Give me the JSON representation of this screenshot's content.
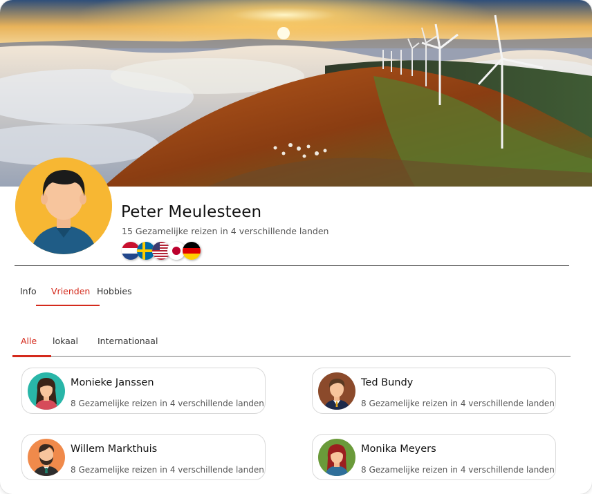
{
  "profile": {
    "name": "Peter Meulesteen",
    "subtitle": "15 Gezamelijke reizen in 4 verschillende landen",
    "flags": [
      "netherlands-flag-icon",
      "sweden-flag-icon",
      "usa-flag-icon",
      "japan-flag-icon",
      "germany-flag-icon"
    ]
  },
  "tabs": {
    "info": "Info",
    "vrienden": "Vrienden",
    "hobbies": "Hobbies",
    "active": "Vrienden"
  },
  "subtabs": {
    "alle": "Alle",
    "lokaal": "lokaal",
    "internationaal": "Internationaal",
    "active": "Alle"
  },
  "friends": [
    {
      "name": "Monieke Janssen",
      "subtitle": "8 Gezamelijke reizen in 4 verschillende landen",
      "avatar": "female-avatar-icon",
      "bg": "#29B6A8"
    },
    {
      "name": "Ted Bundy",
      "subtitle": "8 Gezamelijke reizen in 4 verschillende landen",
      "avatar": "male-avatar-icon",
      "bg": "#8B4A2B"
    },
    {
      "name": "Willem Markthuis",
      "subtitle": "8 Gezamelijke reizen in 4 verschillende landen",
      "avatar": "bearded-male-avatar-icon",
      "bg": "#F08A4B"
    },
    {
      "name": "Monika Meyers",
      "subtitle": "8 Gezamelijke reizen in 4 verschillende landen",
      "avatar": "redhead-female-avatar-icon",
      "bg": "#6A9A3A"
    }
  ],
  "colors": {
    "accent": "#d42a1c",
    "avatar_bg": "#F7B733"
  }
}
